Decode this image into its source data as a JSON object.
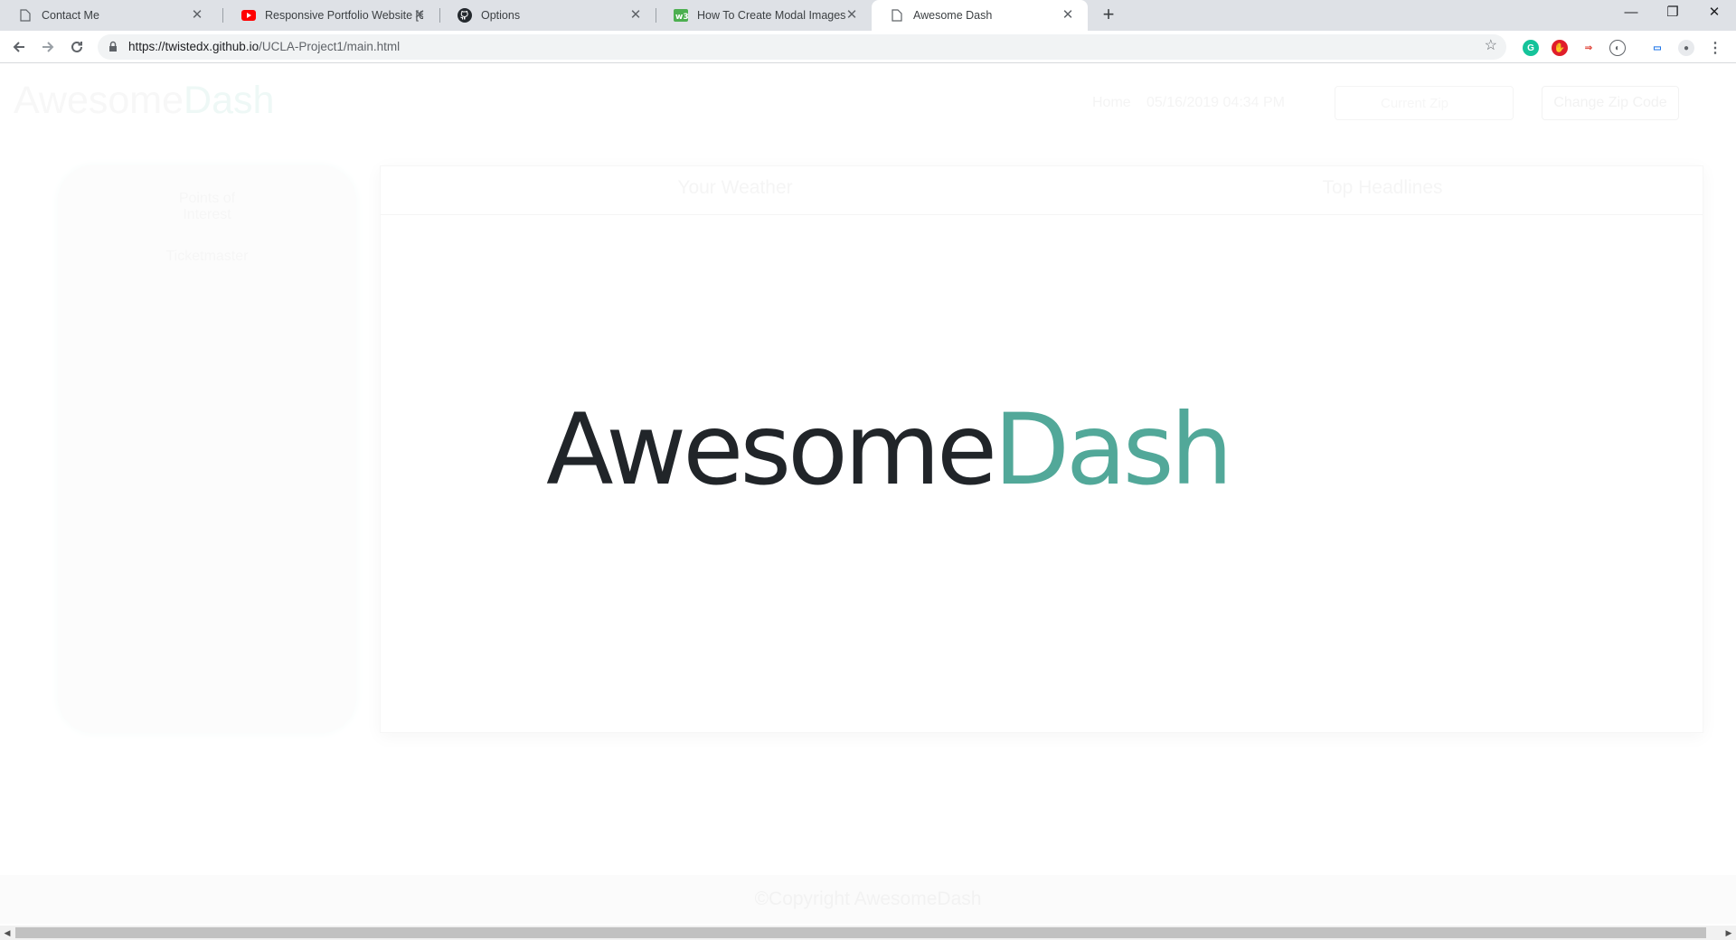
{
  "browser": {
    "tabs": [
      {
        "title": "Contact Me",
        "icon": "page-icon"
      },
      {
        "title": "Responsive Portfolio Website [6]",
        "icon": "youtube-icon"
      },
      {
        "title": "Options",
        "icon": "github-icon"
      },
      {
        "title": "How To Create Modal Images",
        "icon": "w3schools-icon"
      },
      {
        "title": "Awesome Dash",
        "icon": "page-icon",
        "active": true
      }
    ],
    "url_host": "https://twistedx.github.io",
    "url_path": "/UCLA-Project1/main.html",
    "extensions": [
      "grammarly-icon",
      "adblock-icon",
      "extension-icon",
      "shield-icon",
      "cast-icon",
      "profile-icon"
    ]
  },
  "page": {
    "brand_first": "Awesome",
    "brand_second": "Dash",
    "nav": {
      "home": "Home",
      "date": "05/16/2019 04:34 PM",
      "zip_placeholder": "Current Zip",
      "change_zip": "Change Zip Code"
    },
    "sidebar": {
      "items": [
        "Points of Interest",
        "Ticketmaster"
      ]
    },
    "tabs": [
      "Your Weather",
      "Top Headlines"
    ],
    "footer": "©Copyright AwesomeDash"
  },
  "splash": {
    "first": "Awesome",
    "second": "Dash"
  },
  "colors": {
    "brand_dark": "#212529",
    "brand_teal": "#52a899"
  }
}
